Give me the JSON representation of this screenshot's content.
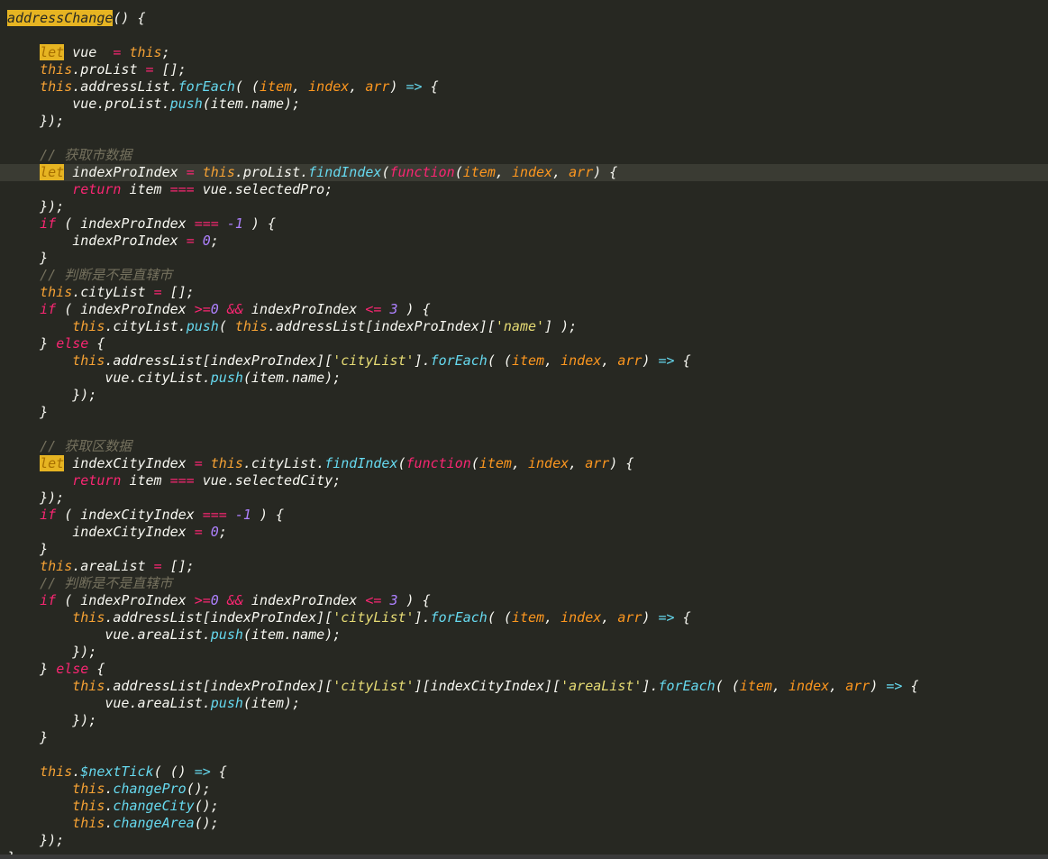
{
  "editor": {
    "language": "javascript",
    "colors": {
      "background": "#272822",
      "keyword": "#f92672",
      "this": "#f6a234",
      "string": "#e6db74",
      "number": "#ae81ff",
      "comment": "#75715e",
      "function": "#66d9ef",
      "param": "#fd971f",
      "highlight": "#e6b422"
    },
    "lines": [
      "addressChange() {",
      "",
      "    let vue  = this;",
      "    this.proList = [];",
      "    this.addressList.forEach( (item, index, arr) => {",
      "        vue.proList.push(item.name);",
      "    });",
      "",
      "    // 获取市数据",
      "    let indexProIndex = this.proList.findIndex(function(item, index, arr) {",
      "        return item === vue.selectedPro;",
      "    });",
      "    if ( indexProIndex === -1 ) {",
      "        indexProIndex = 0;",
      "    }",
      "    // 判断是不是直辖市",
      "    this.cityList = [];",
      "    if ( indexProIndex >=0 && indexProIndex <= 3 ) {",
      "        this.cityList.push( this.addressList[indexProIndex]['name'] );",
      "    } else {",
      "        this.addressList[indexProIndex]['cityList'].forEach( (item, index, arr) => {",
      "            vue.cityList.push(item.name);",
      "        });",
      "    }",
      "",
      "    // 获取区数据",
      "    let indexCityIndex = this.cityList.findIndex(function(item, index, arr) {",
      "        return item === vue.selectedCity;",
      "    });",
      "    if ( indexCityIndex === -1 ) {",
      "        indexCityIndex = 0;",
      "    }",
      "    this.areaList = [];",
      "    // 判断是不是直辖市",
      "    if ( indexProIndex >=0 && indexProIndex <= 3 ) {",
      "        this.addressList[indexProIndex]['cityList'].forEach( (item, index, arr) => {",
      "            vue.areaList.push(item.name);",
      "        });",
      "    } else {",
      "        this.addressList[indexProIndex]['cityList'][indexCityIndex]['areaList'].forEach( (item, index, arr) => {",
      "            vue.areaList.push(item);",
      "        });",
      "    }",
      "",
      "    this.$nextTick( () => {",
      "        this.changePro();",
      "        this.changeCity();",
      "        this.changeArea();",
      "    });",
      "}"
    ]
  }
}
